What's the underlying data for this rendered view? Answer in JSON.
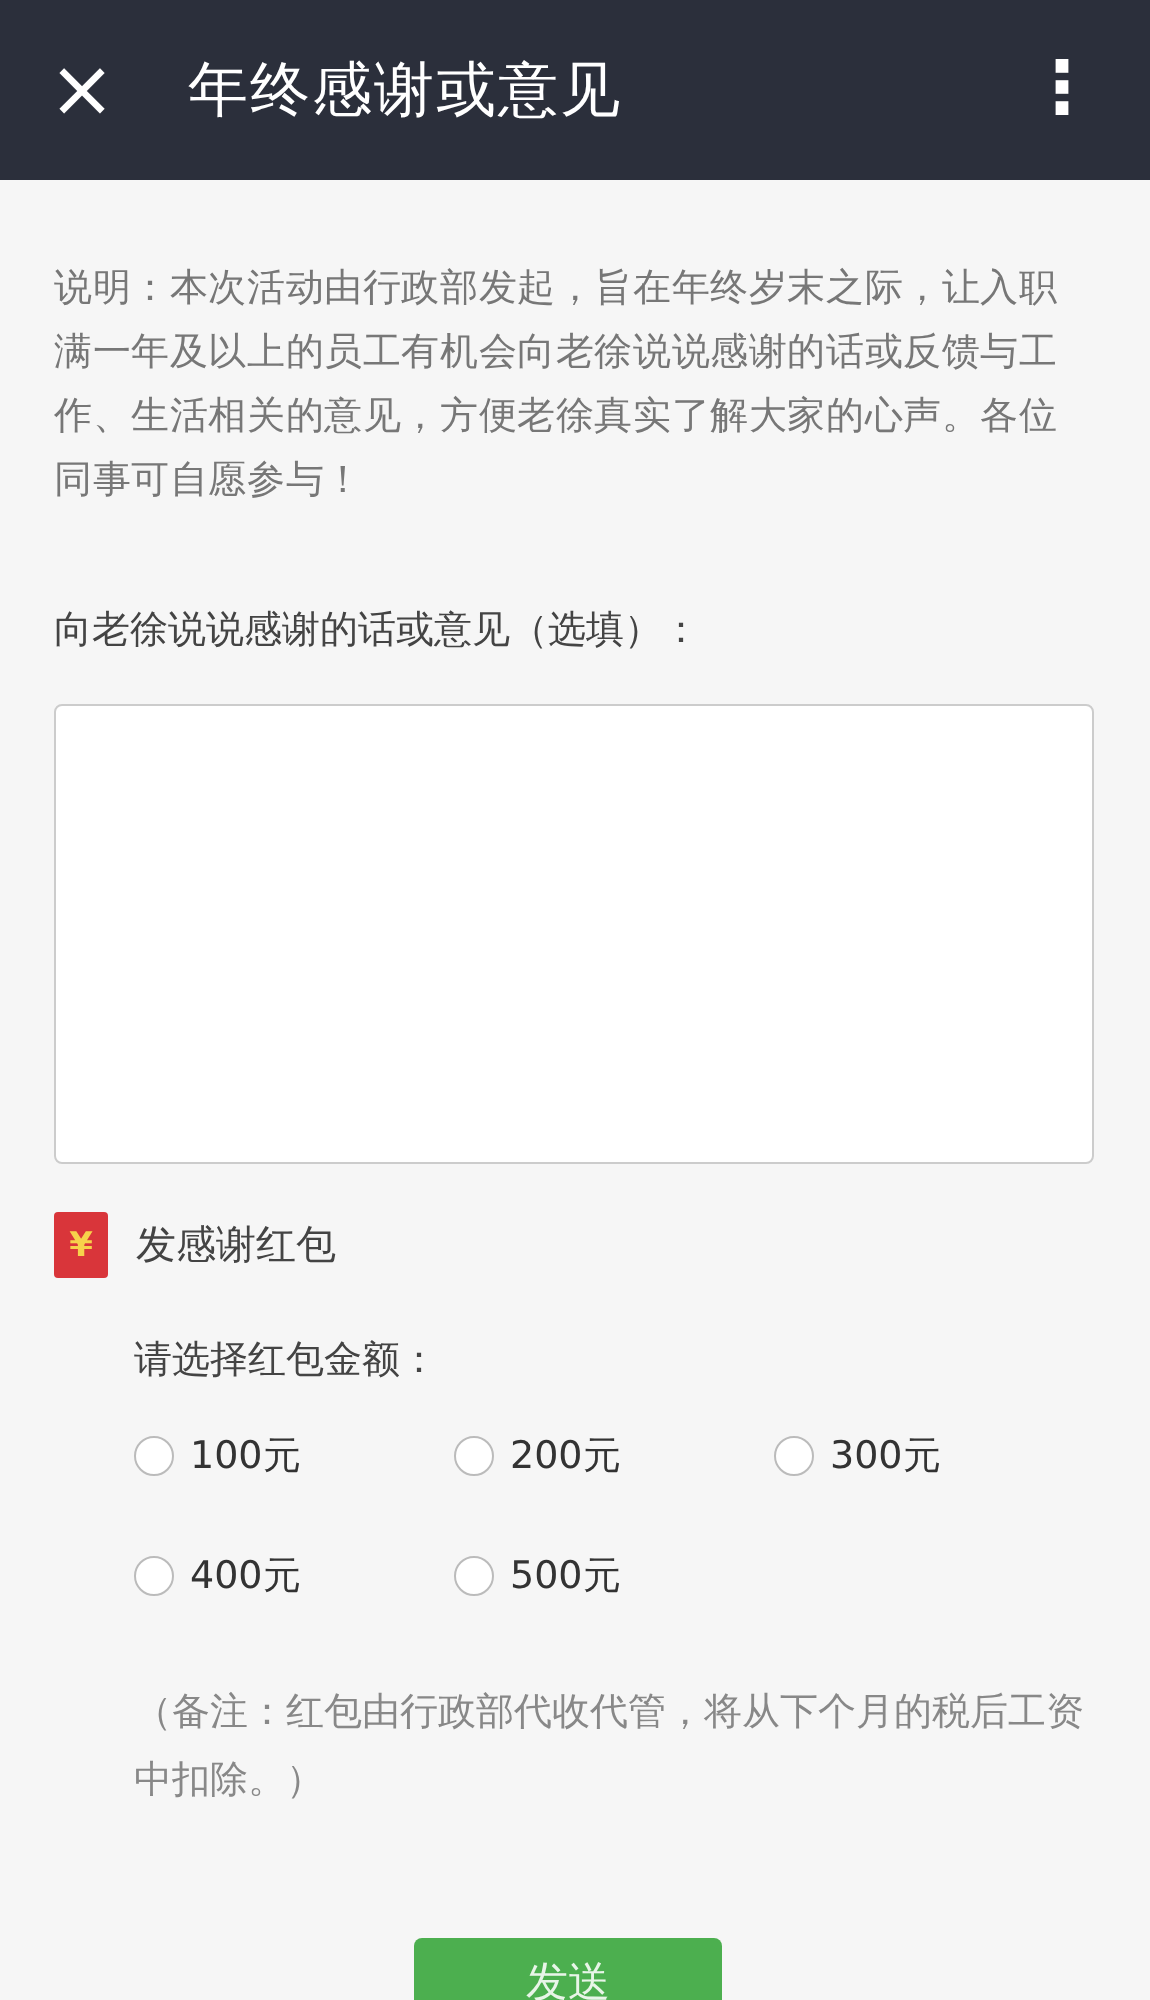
{
  "header": {
    "close_icon": "×",
    "title": "年终感谢或意见",
    "menu_icon": "⋮"
  },
  "description": "说明：本次活动由行政部发起，旨在年终岁末之际，让入职满一年及以上的员工有机会向老徐说说感谢的话或反馈与工作、生活相关的意见，方便老徐真实了解大家的心声。各位同事可自愿参与！",
  "feedback": {
    "label": "向老徐说说感谢的话或意见（选填）："
  },
  "red_packet": {
    "icon_text": "¥",
    "label": "发感谢红包",
    "amount_label": "请选择红包金额：",
    "options": [
      {
        "label": "100元",
        "selected": false
      },
      {
        "label": "200元",
        "selected": false
      },
      {
        "label": "300元",
        "selected": false
      },
      {
        "label": "400元",
        "selected": false
      },
      {
        "label": "500元",
        "selected": false
      }
    ],
    "note": "（备注：红包由行政部代收代管，将从下个月的税后工资中扣除。）"
  },
  "submit": "发送"
}
